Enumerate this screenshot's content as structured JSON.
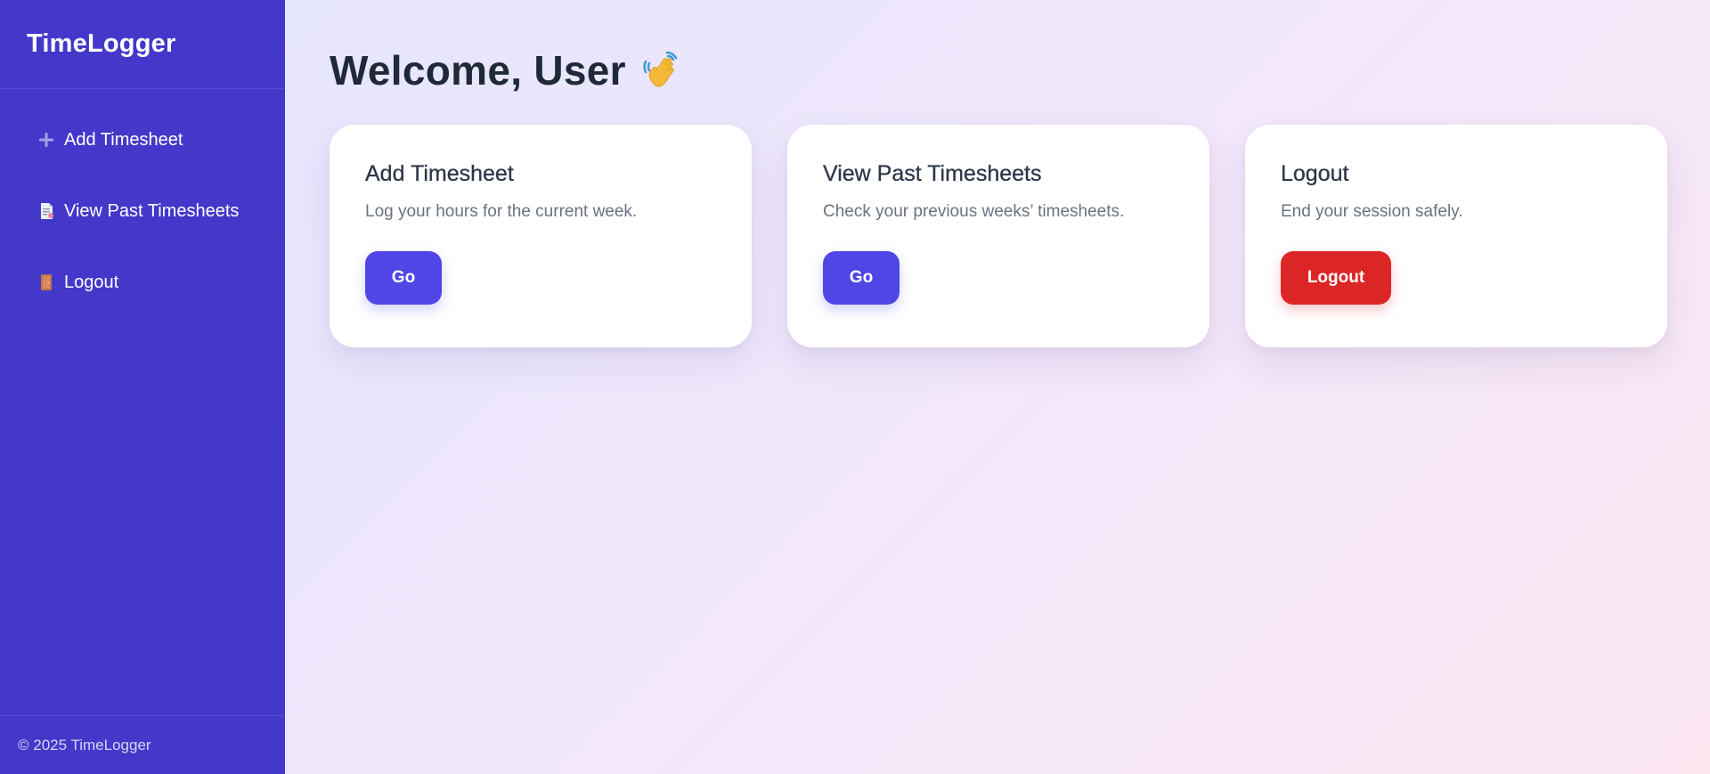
{
  "sidebar": {
    "brand": "TimeLogger",
    "items": [
      {
        "label": "Add Timesheet",
        "icon": "plus-icon"
      },
      {
        "label": "View Past Timesheets",
        "icon": "document-icon"
      },
      {
        "label": "Logout",
        "icon": "door-icon"
      }
    ],
    "footer": "© 2025 TimeLogger"
  },
  "main": {
    "title": "Welcome, User",
    "title_icon": "waving-hand-icon",
    "cards": [
      {
        "title": "Add Timesheet",
        "description": "Log your hours for the current week.",
        "button": "Go"
      },
      {
        "title": "View Past Timesheets",
        "description": "Check your previous weeks’ timesheets.",
        "button": "Go"
      },
      {
        "title": "Logout",
        "description": "End your session safely.",
        "button": "Logout"
      }
    ]
  },
  "colors": {
    "sidebar_bg": "#4338ca",
    "primary_button": "#4f46e5",
    "danger_button": "#dc2626",
    "heading_text": "#1f2937"
  }
}
